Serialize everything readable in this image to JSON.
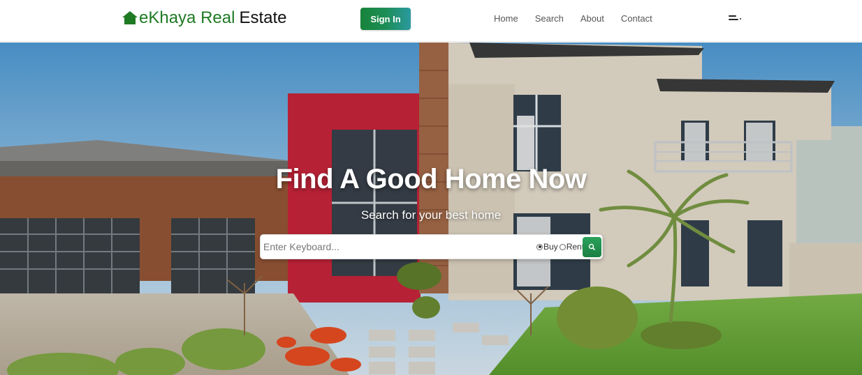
{
  "brand": {
    "name_green": "eKhaya Real",
    "name_dark": "Estate",
    "icon": "house-icon",
    "color_green": "#1f7a24"
  },
  "header": {
    "signin_label": "Sign In",
    "nav": [
      "Home",
      "Search",
      "About",
      "Contact"
    ],
    "menu_icon": "hamburger-icon"
  },
  "hero": {
    "title": "Find A Good Home Now",
    "subtitle": "Search for your best home"
  },
  "search": {
    "placeholder": "Enter Keyboard...",
    "value": "",
    "options": [
      {
        "label": "Buy",
        "selected": true
      },
      {
        "label": "Rent",
        "selected": false
      }
    ],
    "button_icon": "search-icon"
  },
  "colors": {
    "accent": "#1d8d56"
  }
}
